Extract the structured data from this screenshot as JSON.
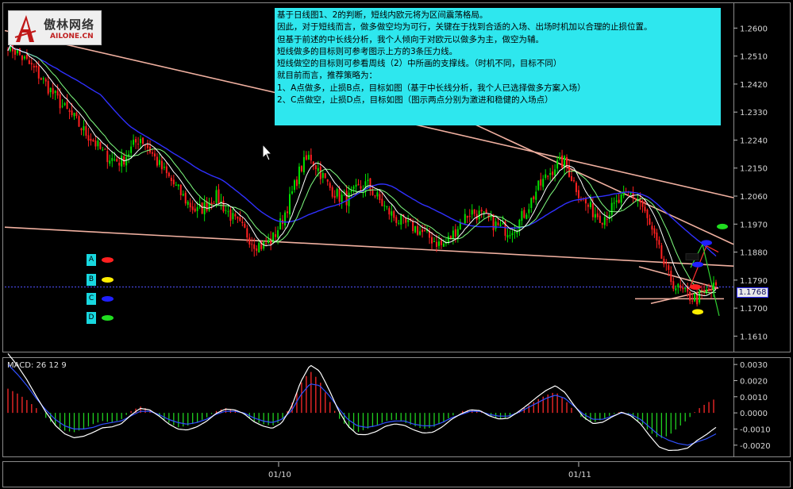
{
  "note": {
    "lines": [
      "基于日线图1、2的判断，短线内欧元将为区间震荡格局。",
      "因此，对于短线而言，做多做空均为可行，关键在于找到合适的入场、出场时机加以合理的止损位置。",
      "但基于前述的中长线分析，我个人倾向于对欧元以做多为主，做空为辅。",
      "短线做多的目标则可参考图示上方的3条压力线。",
      "短线做空的目标则可参看周线（2）中所画的支撑线。（时机不同，目标不同）",
      "就目前而言，推荐策略为：",
      "1、A点做多，止损B点，目标如图（基于中长线分析，我个人已选择做多方案入场）",
      "2、C点做空，止损D点，目标如图（图示两点分别为激进和稳健的入场点）"
    ]
  },
  "logo": {
    "cn": "傲林网络",
    "en": "AILONE.CN"
  },
  "legend": [
    {
      "label": "A",
      "color": "#ff2020"
    },
    {
      "label": "B",
      "color": "#ffee00"
    },
    {
      "label": "C",
      "color": "#2020ff"
    },
    {
      "label": "D",
      "color": "#20dd20"
    }
  ],
  "current_price": "1.1768",
  "macd_label": "MACD: 26 12 9",
  "colors": {
    "up": "#00e000",
    "down": "#ff2020",
    "ma_slow": "#3030ff",
    "ma_fast": "#ffffff",
    "ma_mid": "#80ff80",
    "trend": "#f0b0a0"
  },
  "chart_data": [
    {
      "type": "candlestick",
      "title": "",
      "ylim": [
        1.156,
        1.268
      ],
      "y_ticks": [
        "1.2600",
        "1.2510",
        "1.2420",
        "1.2330",
        "1.2240",
        "1.2150",
        "1.2060",
        "1.1970",
        "1.1880",
        "1.1790",
        "1.1700",
        "1.1610"
      ],
      "x_labels": [
        "01/10",
        "01/11"
      ],
      "close_path": [
        1.255,
        1.252,
        1.249,
        1.246,
        1.242,
        1.238,
        1.234,
        1.231,
        1.227,
        1.224,
        1.22,
        1.218,
        1.217,
        1.221,
        1.225,
        1.221,
        1.216,
        1.212,
        1.208,
        1.204,
        1.201,
        1.203,
        1.206,
        1.202,
        1.198,
        1.195,
        1.191,
        1.19,
        1.192,
        1.198,
        1.206,
        1.215,
        1.219,
        1.214,
        1.209,
        1.206,
        1.205,
        1.208,
        1.21,
        1.206,
        1.202,
        1.199,
        1.197,
        1.196,
        1.194,
        1.192,
        1.19,
        1.193,
        1.198,
        1.201,
        1.2,
        1.198,
        1.196,
        1.195,
        1.197,
        1.202,
        1.208,
        1.212,
        1.216,
        1.217,
        1.21,
        1.204,
        1.201,
        1.199,
        1.202,
        1.205,
        1.207,
        1.204,
        1.196,
        1.188,
        1.18,
        1.176,
        1.174,
        1.173,
        1.175,
        1.177
      ],
      "annotations": [
        "A",
        "B",
        "C",
        "D"
      ]
    },
    {
      "type": "macd",
      "title": "MACD: 26 12 9",
      "ylim": [
        -0.0027,
        0.0034
      ],
      "y_ticks": [
        "0.0030",
        "0.0020",
        "0.0010",
        "0.0000",
        "-0.0010",
        "-0.0020"
      ],
      "histogram": [
        0.0015,
        0.0012,
        0.0008,
        0.0003,
        -0.0003,
        -0.0008,
        -0.0011,
        -0.0012,
        -0.001,
        -0.0007,
        -0.0005,
        -0.0006,
        -0.0004,
        0.0001,
        0.0004,
        0.0002,
        -0.0002,
        -0.0006,
        -0.0009,
        -0.0008,
        -0.0006,
        -0.0003,
        0.0001,
        0.0003,
        0.0002,
        -0.0001,
        -0.0005,
        -0.0007,
        -0.0008,
        -0.0005,
        0.0005,
        0.0018,
        0.0026,
        0.002,
        0.0008,
        -0.0003,
        -0.0009,
        -0.0012,
        -0.001,
        -0.0008,
        -0.0005,
        -0.0004,
        -0.0006,
        -0.0008,
        -0.001,
        -0.0009,
        -0.0006,
        -0.0002,
        0.0001,
        0.0002,
        0.0001,
        -0.0002,
        -0.0004,
        -0.0003,
        0.0001,
        0.0004,
        0.0008,
        0.0011,
        0.0013,
        0.0008,
        0.0001,
        -0.0004,
        -0.0006,
        -0.0004,
        -0.0001,
        0.0001,
        -0.0002,
        -0.0006,
        -0.0012,
        -0.0016,
        -0.0014,
        -0.0009,
        -0.0004,
        0.0002,
        0.0006,
        0.0009
      ],
      "signal": [
        0.003,
        0.0024,
        0.0017,
        0.0009,
        0.0002,
        -0.0004,
        -0.0008,
        -0.001,
        -0.001,
        -0.0009,
        -0.0007,
        -0.0006,
        -0.0005,
        -0.0002,
        0.0001,
        0.0001,
        -0.0001,
        -0.0004,
        -0.0006,
        -0.0007,
        -0.0006,
        -0.0004,
        -0.0001,
        0.0001,
        0.0001,
        0.0,
        -0.0003,
        -0.0005,
        -0.0006,
        -0.0004,
        0.0001,
        0.0011,
        0.0018,
        0.0017,
        0.0011,
        0.0003,
        -0.0004,
        -0.0008,
        -0.0009,
        -0.0008,
        -0.0006,
        -0.0005,
        -0.0005,
        -0.0007,
        -0.0008,
        -0.0008,
        -0.0006,
        -0.0003,
        -0.0001,
        0.0001,
        0.0001,
        -0.0001,
        -0.0002,
        -0.0002,
        0.0,
        0.0003,
        0.0006,
        0.0009,
        0.0011,
        0.0009,
        0.0004,
        -0.0001,
        -0.0004,
        -0.0004,
        -0.0002,
        0.0,
        -0.0001,
        -0.0004,
        -0.0009,
        -0.0014,
        -0.0017,
        -0.0019,
        -0.002,
        -0.0018,
        -0.0016,
        -0.0013
      ]
    }
  ]
}
